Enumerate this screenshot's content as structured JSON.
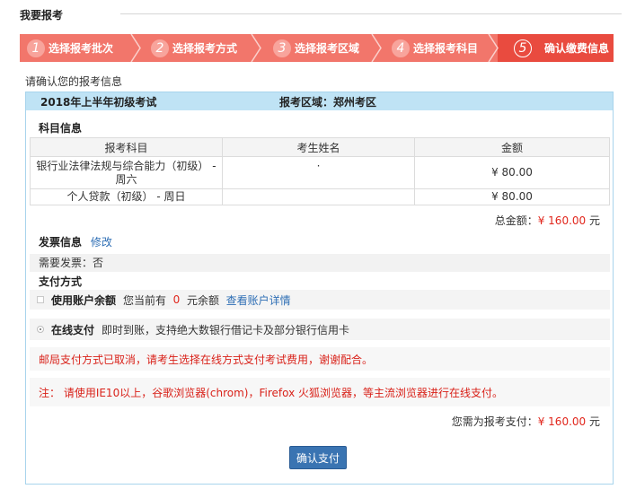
{
  "page": {
    "title": "我要报考"
  },
  "steps": [
    {
      "num": "1",
      "label": "选择报考批次",
      "state": "pending"
    },
    {
      "num": "2",
      "label": "选择报考方式",
      "state": "pending"
    },
    {
      "num": "3",
      "label": "选择报考区域",
      "state": "pending"
    },
    {
      "num": "4",
      "label": "选择报考科目",
      "state": "pending"
    },
    {
      "num": "5",
      "label": "确认缴费信息",
      "state": "current"
    }
  ],
  "intro": "请确认您的报考信息",
  "exam": {
    "name": "2018年上半年初级考试",
    "region": "报考区域：郑州考区"
  },
  "subjects": {
    "title": "科目信息",
    "columns": [
      "报考科目",
      "考生姓名",
      "金额"
    ],
    "rows": [
      {
        "subject": "银行业法律法规与综合能力（初级） - 周六",
        "name": "·",
        "amount": "¥ 80.00"
      },
      {
        "subject": "个人贷款（初级） - 周日",
        "name": "",
        "amount": "¥ 80.00"
      }
    ]
  },
  "total": {
    "label": "总金额：",
    "amount": "¥ 160.00",
    "unit": "元"
  },
  "invoice": {
    "title": "发票信息",
    "edit": "修改",
    "need": "需要发票：否"
  },
  "payment": {
    "title": "支付方式",
    "balance": {
      "label": "使用账户余额",
      "text_before": "您当前有",
      "amount": "0",
      "text_after": "元余额",
      "link": "查看账户详情"
    },
    "online": {
      "label": "在线支付",
      "desc": "即时到账，支持绝大数银行借记卡及部分银行信用卡"
    },
    "notice1": "邮局支付方式已取消，请考生选择在线方式支付考试费用，谢谢配合。",
    "notice2": "注：  请使用IE10以上，谷歌浏览器(chrom)，Firefox 火狐浏览器，等主流浏览器进行在线支付。"
  },
  "pay_total": {
    "label": "您需为报考支付：",
    "amount": "¥ 160.00",
    "unit": "元"
  },
  "confirm_button": "确认支付",
  "colors": {
    "step_pending": "#f2766b",
    "step_current": "#e94b3f",
    "panel_head": "#bfe3f5",
    "accent_red": "#e1261c",
    "button": "#3a74b2"
  }
}
